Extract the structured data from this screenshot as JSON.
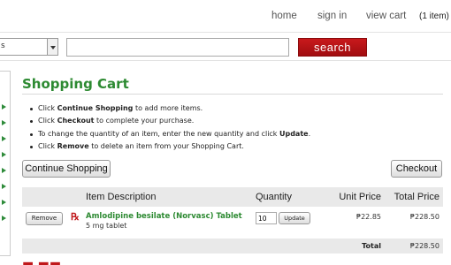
{
  "nav": {
    "home": "home",
    "sign_in": "sign in",
    "view_cart": "view cart",
    "cart_count": "(1 item)"
  },
  "search": {
    "category_value": "s",
    "query": "",
    "button_label": "search"
  },
  "page": {
    "title": "Shopping Cart",
    "instructions": [
      {
        "pre": "Click ",
        "bold": "Continue Shopping",
        "post": " to add more items."
      },
      {
        "pre": "Click ",
        "bold": "Checkout",
        "post": " to complete your purchase."
      },
      {
        "pre": "To change the quantity of an item, enter the new quantity and click ",
        "bold": "Update",
        "post": "."
      },
      {
        "pre": "Click ",
        "bold": "Remove",
        "post": " to delete an item from your Shopping Cart."
      }
    ],
    "continue_label": "Continue Shopping",
    "checkout_label": "Checkout"
  },
  "cart": {
    "headers": {
      "description": "Item Description",
      "quantity": "Quantity",
      "unit_price": "Unit Price",
      "total_price": "Total Price"
    },
    "items": [
      {
        "remove_label": "Remove",
        "rx_symbol": "℞",
        "name": "Amlodipine besilate (Norvasc) Tablet",
        "detail": "5 mg tablet",
        "quantity": "10",
        "update_label": "Update",
        "unit_price": "₱22.85",
        "total_price": "₱228.50"
      }
    ],
    "total_label": "Total",
    "total_value": "₱228.50"
  },
  "colors": {
    "accent_green": "#2d8a32",
    "search_red": "#c0181b"
  }
}
